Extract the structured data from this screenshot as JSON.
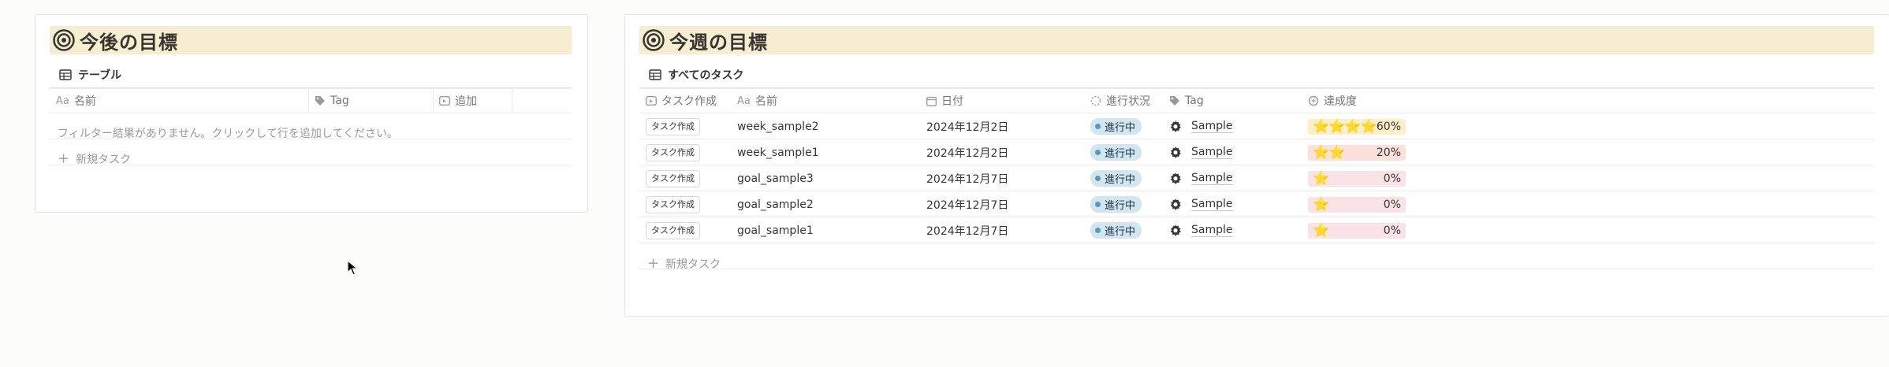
{
  "left_panel": {
    "title": "今後の目標",
    "view_tab": "テーブル",
    "columns": [
      "名前",
      "Tag",
      "追加"
    ],
    "empty_message": "フィルター結果がありません。クリックして行を追加してください。",
    "new_task": "新規タスク"
  },
  "right_panel": {
    "title": "今週の目標",
    "view_tab": "すべてのタスク",
    "columns": [
      "タスク作成",
      "名前",
      "日付",
      "進行状況",
      "Tag",
      "達成度"
    ],
    "rows": [
      {
        "button": "タスク作成",
        "name": "week_sample2",
        "date": "2024年12月2日",
        "status": "進行中",
        "tag": "Sample",
        "stars": "⭐⭐⭐⭐",
        "percent": "60%",
        "progress_value": 60,
        "progress_color": "#fbeecb"
      },
      {
        "button": "タスク作成",
        "name": "week_sample1",
        "date": "2024年12月2日",
        "status": "進行中",
        "tag": "Sample",
        "stars": "⭐⭐",
        "percent": "20%",
        "progress_value": 20,
        "progress_color": "#fbe0dc"
      },
      {
        "button": "タスク作成",
        "name": "goal_sample3",
        "date": "2024年12月7日",
        "status": "進行中",
        "tag": "Sample",
        "stars": "⭐",
        "percent": "0%",
        "progress_value": 0,
        "progress_color": "#f9e3e6"
      },
      {
        "button": "タスク作成",
        "name": "goal_sample2",
        "date": "2024年12月7日",
        "status": "進行中",
        "tag": "Sample",
        "stars": "⭐",
        "percent": "0%",
        "progress_value": 0,
        "progress_color": "#f9e3e6"
      },
      {
        "button": "タスク作成",
        "name": "goal_sample1",
        "date": "2024年12月7日",
        "status": "進行中",
        "tag": "Sample",
        "stars": "⭐",
        "percent": "0%",
        "progress_value": 0,
        "progress_color": "#f9e3e6"
      }
    ],
    "new_task": "新規タスク"
  },
  "colors": {
    "header_bg": "#f7edd3",
    "status_bg": "#d3e5ef",
    "status_dot": "#5b97bd"
  },
  "icons": {
    "header": "target-icon",
    "view": "table-icon",
    "name_col": "text-property-icon",
    "tag_col": "tag-icon",
    "date_col": "calendar-icon",
    "status_col": "status-icon",
    "progress_col": "formula-icon",
    "button_col": "button-property-icon",
    "tag_value": "gear-icon"
  }
}
